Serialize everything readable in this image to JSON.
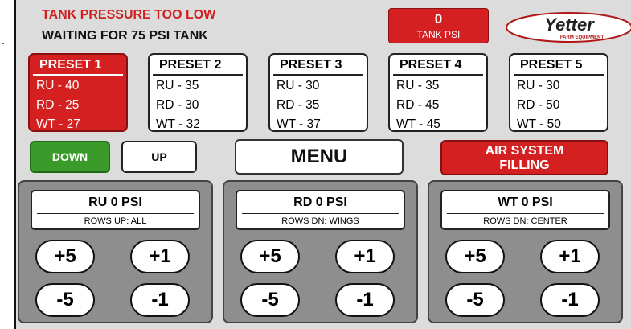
{
  "marker": ".",
  "alerts": {
    "line1": "TANK PRESSURE TOO LOW",
    "line2": "WAITING FOR 75 PSI TANK"
  },
  "tank": {
    "value": "0",
    "label": "TANK PSI"
  },
  "logo": {
    "name": "Yetter",
    "sub": "FARM EQUIPMENT"
  },
  "presets": [
    {
      "title": "PRESET 1",
      "ru": "RU - 40",
      "rd": "RD - 25",
      "wt": "WT - 27",
      "active": true
    },
    {
      "title": "PRESET 2",
      "ru": "RU - 35",
      "rd": "RD - 30",
      "wt": "WT - 32",
      "active": false
    },
    {
      "title": "PRESET 3",
      "ru": "RU - 30",
      "rd": "RD - 35",
      "wt": "WT - 37",
      "active": false
    },
    {
      "title": "PRESET 4",
      "ru": "RU - 35",
      "rd": "RD - 45",
      "wt": "WT - 45",
      "active": false
    },
    {
      "title": "PRESET 5",
      "ru": "RU - 30",
      "rd": "RD - 50",
      "wt": "WT - 50",
      "active": false
    }
  ],
  "controls": {
    "down": "DOWN",
    "up": "UP",
    "menu": "MENU",
    "air_line1": "AIR SYSTEM",
    "air_line2": "FILLING"
  },
  "panels": [
    {
      "title": "RU 0 PSI",
      "sub": "ROWS UP: ALL",
      "p5": "+5",
      "p1": "+1",
      "m5": "-5",
      "m1": "-1"
    },
    {
      "title": "RD 0 PSI",
      "sub": "ROWS DN: WINGS",
      "p5": "+5",
      "p1": "+1",
      "m5": "-5",
      "m1": "-1"
    },
    {
      "title": "WT 0 PSI",
      "sub": "ROWS DN: CENTER",
      "p5": "+5",
      "p1": "+1",
      "m5": "-5",
      "m1": "-1"
    }
  ],
  "colors": {
    "alert_red": "#d01f1f",
    "button_red": "#d42020",
    "button_green": "#3a9a2a",
    "panel_gray": "#8e8e8e",
    "background": "#dcdcdc"
  }
}
